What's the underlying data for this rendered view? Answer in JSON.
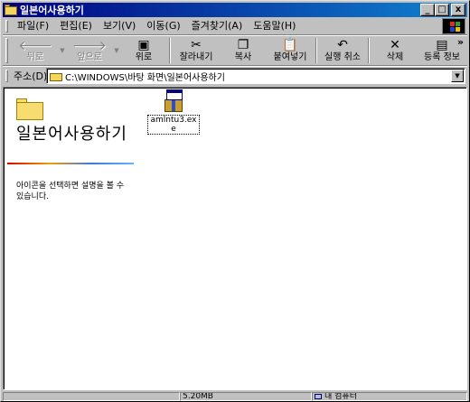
{
  "window": {
    "title": "일본어사용하기",
    "title_buttons": {
      "minimize": "_",
      "maximize": "□",
      "close": "x"
    },
    "titlebar_colors": [
      "#000080",
      "#1084d0"
    ]
  },
  "menu": {
    "items": [
      "파일(F)",
      "편집(E)",
      "보기(V)",
      "이동(G)",
      "즐겨찾기(A)",
      "도움말(H)"
    ]
  },
  "toolbar": {
    "buttons": [
      {
        "label": "뒤로",
        "icon": "back-arrow-icon",
        "glyph": "🡐",
        "enabled": false
      },
      {
        "label": "앞으로",
        "icon": "forward-arrow-icon",
        "glyph": "🡒",
        "enabled": false
      },
      {
        "label": "위로",
        "icon": "up-folder-icon",
        "glyph": "▣",
        "enabled": true
      },
      {
        "label": "잘라내기",
        "icon": "cut-icon",
        "glyph": "✂",
        "enabled": true
      },
      {
        "label": "복사",
        "icon": "copy-icon",
        "glyph": "❐",
        "enabled": true
      },
      {
        "label": "붙여넣기",
        "icon": "paste-icon",
        "glyph": "📋",
        "enabled": true
      },
      {
        "label": "실행 취소",
        "icon": "undo-icon",
        "glyph": "↶",
        "enabled": true
      },
      {
        "label": "삭제",
        "icon": "delete-icon",
        "glyph": "✕",
        "enabled": true
      },
      {
        "label": "등록 정보",
        "icon": "properties-icon",
        "glyph": "▤",
        "enabled": true
      }
    ],
    "more": "»"
  },
  "address": {
    "label": "주소(D)",
    "value": "C:\\WINDOWS\\바탕 화면\\일본어사용하기"
  },
  "panel": {
    "folder_name": "일본어사용하기",
    "hint": "아이콘을 선택하면 설명을 볼 수 있습니다."
  },
  "files": [
    {
      "name": "amlntu3.exe",
      "icon": "installer-icon"
    }
  ],
  "status": {
    "cells": [
      "",
      "5.20MB",
      "내 컴퓨터"
    ]
  }
}
